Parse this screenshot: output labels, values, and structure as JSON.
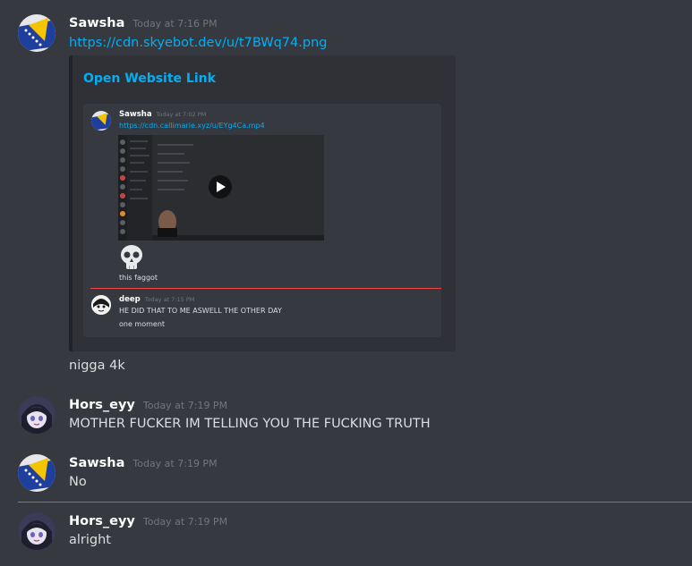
{
  "messages": [
    {
      "user": "Sawsha",
      "timestamp": "Today at 7:16 PM",
      "link": "https://cdn.skyebot.dev/u/t7BWq74.png",
      "embed": {
        "title": "Open Website Link",
        "preview": {
          "m1_user": "Sawsha",
          "m1_timestamp": "Today at 7:02 PM",
          "m1_link": "https://cdn.callimarie.xyz/u/EYg4Ca.mp4",
          "m1_reaction_text": "this faggot",
          "m2_user": "deep",
          "m2_timestamp": "Today at 7:15 PM",
          "m2_line1": "HE DID THAT TO ME ASWELL THE OTHER DAY",
          "m2_line2": "one moment"
        }
      },
      "followup": "nigga 4k"
    },
    {
      "user": "Hors_eyy",
      "timestamp": "Today at 7:19 PM",
      "text": "MOTHER FUCKER IM TELLING YOU THE FUCKING TRUTH"
    },
    {
      "user": "Sawsha",
      "timestamp": "Today at 7:19 PM",
      "text": "No"
    },
    {
      "user": "Hors_eyy",
      "timestamp": "Today at 7:19 PM",
      "text": "alright"
    }
  ],
  "colors": {
    "background": "#36393f",
    "link": "#00b0f4",
    "new_messages_divider": "#f04747"
  }
}
